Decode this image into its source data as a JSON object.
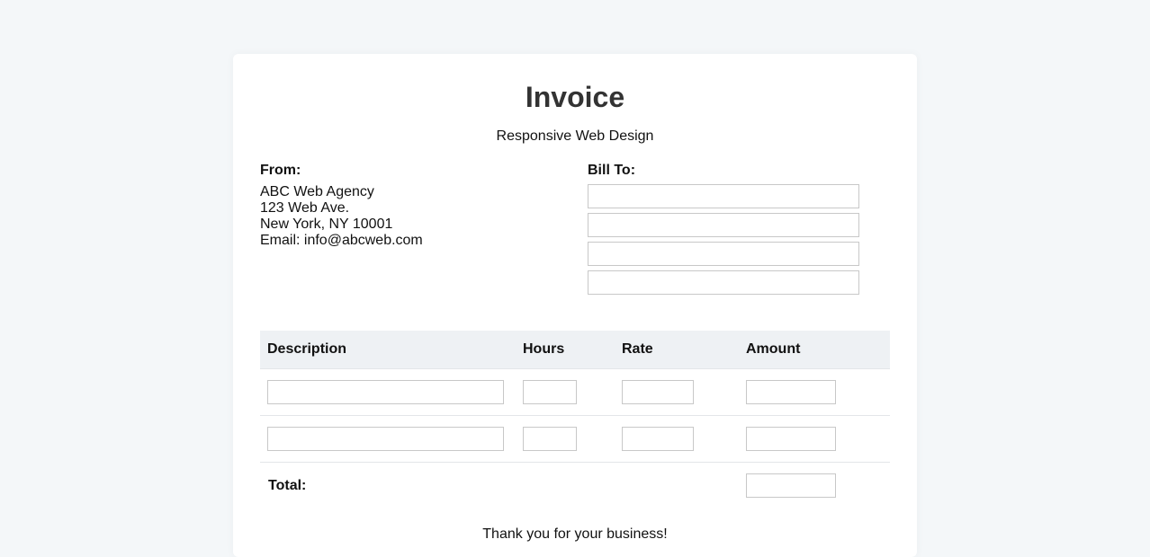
{
  "invoice": {
    "title": "Invoice",
    "subtitle": "Responsive Web Design"
  },
  "from": {
    "heading": "From:",
    "lines": [
      "ABC Web Agency",
      "123 Web Ave.",
      "New York, NY 10001",
      "Email: info@abcweb.com"
    ]
  },
  "bill_to": {
    "heading": "Bill To:",
    "fields": [
      "",
      "",
      "",
      ""
    ]
  },
  "table": {
    "headers": [
      "Description",
      "Hours",
      "Rate",
      "Amount"
    ],
    "rows": [
      {
        "description": "",
        "hours": "",
        "rate": "",
        "amount": ""
      },
      {
        "description": "",
        "hours": "",
        "rate": "",
        "amount": ""
      }
    ],
    "total_label": "Total:",
    "total_value": ""
  },
  "footer": {
    "thanks": "Thank you for your business!"
  }
}
